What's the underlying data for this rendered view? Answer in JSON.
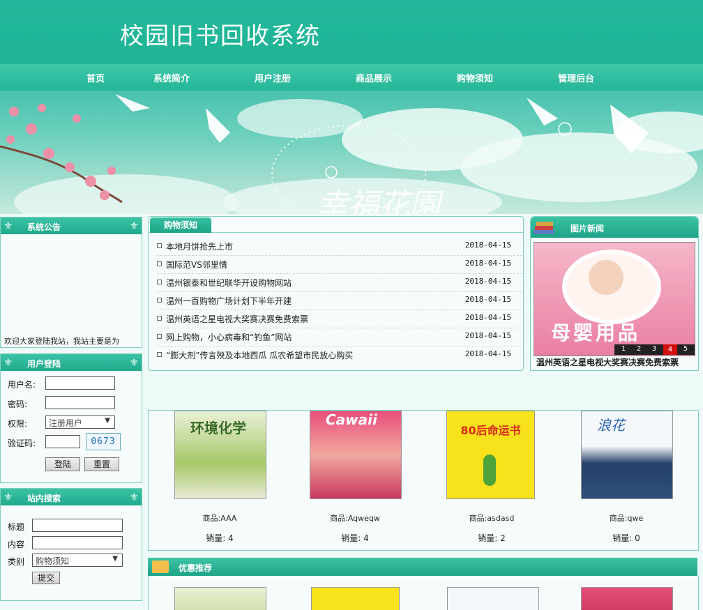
{
  "header": {
    "title": "校园旧书回收系统"
  },
  "nav": [
    "首页",
    "系统简介",
    "用户注册",
    "商品展示",
    "购物须知",
    "管理后台"
  ],
  "banner": {
    "text": "幸福花園"
  },
  "announcement": {
    "title": "系统公告",
    "text": "欢迎大家登陆我站，我站主要是为"
  },
  "login": {
    "title": "用户登陆",
    "username_label": "用户名:",
    "password_label": "密码:",
    "role_label": "权限:",
    "role_value": "注册用户",
    "captcha_label": "验证码:",
    "captcha_code": "0673",
    "login_button": "登陆",
    "reset_button": "重置"
  },
  "search": {
    "title": "站内搜索",
    "title_label": "标题",
    "content_label": "内容",
    "category_label": "类别",
    "category_value": "购物须知",
    "submit_button": "提交"
  },
  "shopping": {
    "tab": "购物须知",
    "items": [
      {
        "title": "本地月饼抢先上市",
        "date": "2018-04-15"
      },
      {
        "title": "国际范VS邻里情",
        "date": "2018-04-15"
      },
      {
        "title": "温州银泰和世纪联华开设购物网站",
        "date": "2018-04-15"
      },
      {
        "title": "温州一百购物广场计划下半年开建",
        "date": "2018-04-15"
      },
      {
        "title": "温州英语之星电视大奖赛决赛免费索票",
        "date": "2018-04-15"
      },
      {
        "title": "网上购物，小心病毒和“钓鱼”网站",
        "date": "2018-04-15"
      },
      {
        "title": "“膨大剂”传言殃及本地西瓜 瓜农希望市民放心购买",
        "date": "2018-04-15"
      }
    ]
  },
  "picnews": {
    "title": "图片新闻",
    "caption": "温州英语之星电视大奖赛决赛免费索票",
    "image_text": "母婴用品",
    "pages": [
      "1",
      "2",
      "3",
      "4",
      "5"
    ],
    "active_page": "4"
  },
  "products": [
    {
      "name": "商品:AAA",
      "sales": "销量: 4",
      "cover_text": "环境化学"
    },
    {
      "name": "商品:Aqweqw",
      "sales": "销量: 4",
      "cover_text": "Cawaii"
    },
    {
      "name": "商品:asdasd",
      "sales": "销量: 2",
      "cover_text": "80后命运书"
    },
    {
      "name": "商品:qwe",
      "sales": "销量: 0",
      "cover_text": "浪花"
    }
  ],
  "recommend": {
    "title": "优惠推荐"
  },
  "colors": {
    "primary": "#20b394",
    "accent": "#1aa285",
    "page_bg": "#eefaf7"
  }
}
